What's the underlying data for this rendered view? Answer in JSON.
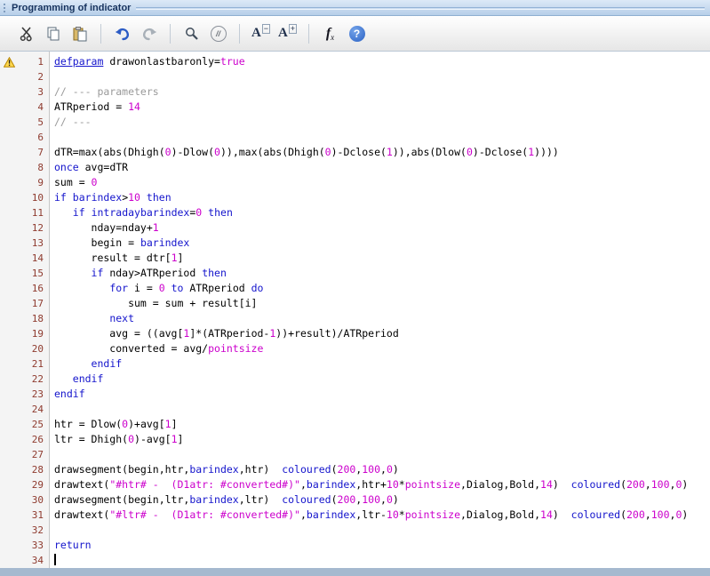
{
  "window": {
    "title": "Programming of indicator"
  },
  "toolbar": {
    "comment_glyph": "//",
    "font_decrease": {
      "letter": "A",
      "sign": "−"
    },
    "font_increase": {
      "letter": "A",
      "sign": "+"
    },
    "fx": {
      "f": "f",
      "x": "x"
    },
    "help_glyph": "?"
  },
  "colors": {
    "keyword": "#1414cc",
    "literal": "#cc00cc",
    "comment": "#9a9a9a",
    "line_number": "#8e3a2e",
    "titlebar_text": "#17335e",
    "warning_fill": "#ffd84d"
  },
  "editor": {
    "warning_line": 1,
    "cursor_line": 34,
    "lines": [
      {
        "n": 1,
        "t": [
          [
            "ku",
            "defparam"
          ],
          [
            "p",
            " drawonlastbaronly="
          ],
          [
            "m",
            "true"
          ]
        ]
      },
      {
        "n": 2,
        "t": []
      },
      {
        "n": 3,
        "t": [
          [
            "c",
            "// --- parameters"
          ]
        ]
      },
      {
        "n": 4,
        "t": [
          [
            "p",
            "ATRperiod = "
          ],
          [
            "m",
            "14"
          ]
        ]
      },
      {
        "n": 5,
        "t": [
          [
            "c",
            "// ---"
          ]
        ]
      },
      {
        "n": 6,
        "t": []
      },
      {
        "n": 7,
        "t": [
          [
            "p",
            "dTR=max(abs(Dhigh("
          ],
          [
            "m",
            "0"
          ],
          [
            "p",
            ")-Dlow("
          ],
          [
            "m",
            "0"
          ],
          [
            "p",
            ")),max(abs(Dhigh("
          ],
          [
            "m",
            "0"
          ],
          [
            "p",
            ")-Dclose("
          ],
          [
            "m",
            "1"
          ],
          [
            "p",
            ")),abs(Dlow("
          ],
          [
            "m",
            "0"
          ],
          [
            "p",
            ")-Dclose("
          ],
          [
            "m",
            "1"
          ],
          [
            "p",
            "))))"
          ]
        ]
      },
      {
        "n": 8,
        "t": [
          [
            "k",
            "once"
          ],
          [
            "p",
            " avg=dTR"
          ]
        ]
      },
      {
        "n": 9,
        "t": [
          [
            "p",
            "sum = "
          ],
          [
            "m",
            "0"
          ]
        ]
      },
      {
        "n": 10,
        "t": [
          [
            "k",
            "if"
          ],
          [
            "p",
            " "
          ],
          [
            "k",
            "barindex"
          ],
          [
            "p",
            ">"
          ],
          [
            "m",
            "10"
          ],
          [
            "p",
            " "
          ],
          [
            "k",
            "then"
          ]
        ]
      },
      {
        "n": 11,
        "t": [
          [
            "p",
            "   "
          ],
          [
            "k",
            "if"
          ],
          [
            "p",
            " "
          ],
          [
            "k",
            "intradaybarindex"
          ],
          [
            "p",
            "="
          ],
          [
            "m",
            "0"
          ],
          [
            "p",
            " "
          ],
          [
            "k",
            "then"
          ]
        ]
      },
      {
        "n": 12,
        "t": [
          [
            "p",
            "      nday=nday+"
          ],
          [
            "m",
            "1"
          ]
        ]
      },
      {
        "n": 13,
        "t": [
          [
            "p",
            "      begin = "
          ],
          [
            "k",
            "barindex"
          ]
        ]
      },
      {
        "n": 14,
        "t": [
          [
            "p",
            "      result = dtr["
          ],
          [
            "m",
            "1"
          ],
          [
            "p",
            "]"
          ]
        ]
      },
      {
        "n": 15,
        "t": [
          [
            "p",
            "      "
          ],
          [
            "k",
            "if"
          ],
          [
            "p",
            " nday>ATRperiod "
          ],
          [
            "k",
            "then"
          ]
        ]
      },
      {
        "n": 16,
        "t": [
          [
            "p",
            "         "
          ],
          [
            "k",
            "for"
          ],
          [
            "p",
            " i = "
          ],
          [
            "m",
            "0"
          ],
          [
            "p",
            " "
          ],
          [
            "k",
            "to"
          ],
          [
            "p",
            " ATRperiod "
          ],
          [
            "k",
            "do"
          ]
        ]
      },
      {
        "n": 17,
        "t": [
          [
            "p",
            "            sum = sum + result[i]"
          ]
        ]
      },
      {
        "n": 18,
        "t": [
          [
            "p",
            "         "
          ],
          [
            "k",
            "next"
          ]
        ]
      },
      {
        "n": 19,
        "t": [
          [
            "p",
            "         avg = ((avg["
          ],
          [
            "m",
            "1"
          ],
          [
            "p",
            "]*(ATRperiod-"
          ],
          [
            "m",
            "1"
          ],
          [
            "p",
            "))+result)/ATRperiod"
          ]
        ]
      },
      {
        "n": 20,
        "t": [
          [
            "p",
            "         converted = avg/"
          ],
          [
            "m",
            "pointsize"
          ]
        ]
      },
      {
        "n": 21,
        "t": [
          [
            "p",
            "      "
          ],
          [
            "k",
            "endif"
          ]
        ]
      },
      {
        "n": 22,
        "t": [
          [
            "p",
            "   "
          ],
          [
            "k",
            "endif"
          ]
        ]
      },
      {
        "n": 23,
        "t": [
          [
            "k",
            "endif"
          ]
        ]
      },
      {
        "n": 24,
        "t": []
      },
      {
        "n": 25,
        "t": [
          [
            "p",
            "htr = Dlow("
          ],
          [
            "m",
            "0"
          ],
          [
            "p",
            ")+avg["
          ],
          [
            "m",
            "1"
          ],
          [
            "p",
            "]"
          ]
        ]
      },
      {
        "n": 26,
        "t": [
          [
            "p",
            "ltr = Dhigh("
          ],
          [
            "m",
            "0"
          ],
          [
            "p",
            ")-avg["
          ],
          [
            "m",
            "1"
          ],
          [
            "p",
            "]"
          ]
        ]
      },
      {
        "n": 27,
        "t": []
      },
      {
        "n": 28,
        "t": [
          [
            "p",
            "drawsegment(begin,htr,"
          ],
          [
            "k",
            "barindex"
          ],
          [
            "p",
            ",htr)  "
          ],
          [
            "k",
            "coloured"
          ],
          [
            "p",
            "("
          ],
          [
            "m",
            "200"
          ],
          [
            "p",
            ","
          ],
          [
            "m",
            "100"
          ],
          [
            "p",
            ","
          ],
          [
            "m",
            "0"
          ],
          [
            "p",
            ")"
          ]
        ]
      },
      {
        "n": 29,
        "t": [
          [
            "p",
            "drawtext("
          ],
          [
            "m",
            "\"#htr# -  (D1atr: #converted#)\""
          ],
          [
            "p",
            ","
          ],
          [
            "k",
            "barindex"
          ],
          [
            "p",
            ",htr+"
          ],
          [
            "m",
            "10"
          ],
          [
            "p",
            "*"
          ],
          [
            "m",
            "pointsize"
          ],
          [
            "p",
            ",Dialog,Bold,"
          ],
          [
            "m",
            "14"
          ],
          [
            "p",
            ")  "
          ],
          [
            "k",
            "coloured"
          ],
          [
            "p",
            "("
          ],
          [
            "m",
            "200"
          ],
          [
            "p",
            ","
          ],
          [
            "m",
            "100"
          ],
          [
            "p",
            ","
          ],
          [
            "m",
            "0"
          ],
          [
            "p",
            ")"
          ]
        ]
      },
      {
        "n": 30,
        "t": [
          [
            "p",
            "drawsegment(begin,ltr,"
          ],
          [
            "k",
            "barindex"
          ],
          [
            "p",
            ",ltr)  "
          ],
          [
            "k",
            "coloured"
          ],
          [
            "p",
            "("
          ],
          [
            "m",
            "200"
          ],
          [
            "p",
            ","
          ],
          [
            "m",
            "100"
          ],
          [
            "p",
            ","
          ],
          [
            "m",
            "0"
          ],
          [
            "p",
            ")"
          ]
        ]
      },
      {
        "n": 31,
        "t": [
          [
            "p",
            "drawtext("
          ],
          [
            "m",
            "\"#ltr# -  (D1atr: #converted#)\""
          ],
          [
            "p",
            ","
          ],
          [
            "k",
            "barindex"
          ],
          [
            "p",
            ",ltr-"
          ],
          [
            "m",
            "10"
          ],
          [
            "p",
            "*"
          ],
          [
            "m",
            "pointsize"
          ],
          [
            "p",
            ",Dialog,Bold,"
          ],
          [
            "m",
            "14"
          ],
          [
            "p",
            ")  "
          ],
          [
            "k",
            "coloured"
          ],
          [
            "p",
            "("
          ],
          [
            "m",
            "200"
          ],
          [
            "p",
            ","
          ],
          [
            "m",
            "100"
          ],
          [
            "p",
            ","
          ],
          [
            "m",
            "0"
          ],
          [
            "p",
            ")"
          ]
        ]
      },
      {
        "n": 32,
        "t": []
      },
      {
        "n": 33,
        "t": [
          [
            "k",
            "return"
          ]
        ]
      },
      {
        "n": 34,
        "t": []
      }
    ]
  }
}
